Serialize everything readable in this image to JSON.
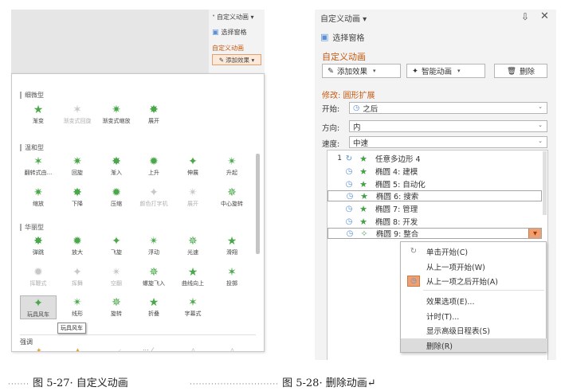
{
  "left_panel": {
    "pane_title": "自定义动画 ▾",
    "select_pane": "选择窗格",
    "subheading": "自定义动画",
    "add_effect": "添加效果 ▾",
    "sections": [
      {
        "title": "细微型",
        "items": [
          {
            "label": "渐变",
            "grey": false
          },
          {
            "label": "渐变式回旋",
            "grey": true
          },
          {
            "label": "渐变式缩放",
            "grey": false
          },
          {
            "label": "展开",
            "grey": false
          }
        ]
      },
      {
        "title": "温和型",
        "items": [
          {
            "label": "翻转式由...",
            "grey": false
          },
          {
            "label": "回旋",
            "grey": false
          },
          {
            "label": "渐入",
            "grey": false
          },
          {
            "label": "上升",
            "grey": false
          },
          {
            "label": "伸展",
            "grey": false
          },
          {
            "label": "升起",
            "grey": false
          },
          {
            "label": "缩放",
            "grey": false
          },
          {
            "label": "下降",
            "grey": false
          },
          {
            "label": "压缩",
            "grey": false
          },
          {
            "label": "颜色打字机",
            "grey": true
          },
          {
            "label": "展开",
            "grey": true
          },
          {
            "label": "中心旋转",
            "grey": false
          }
        ]
      },
      {
        "title": "华丽型",
        "items": [
          {
            "label": "弹跳",
            "grey": false
          },
          {
            "label": "放大",
            "grey": false
          },
          {
            "label": "飞旋",
            "grey": false
          },
          {
            "label": "浮动",
            "grey": false
          },
          {
            "label": "光速",
            "grey": false
          },
          {
            "label": "滑翔",
            "grey": false
          },
          {
            "label": "挥鞭式",
            "grey": true
          },
          {
            "label": "挥舞",
            "grey": true
          },
          {
            "label": "空翻",
            "grey": true
          },
          {
            "label": "螺旋飞入",
            "grey": false
          },
          {
            "label": "曲线向上",
            "grey": false
          },
          {
            "label": "投掷",
            "grey": false
          },
          {
            "label": "玩具风车",
            "grey": false
          },
          {
            "label": "线形",
            "grey": false
          },
          {
            "label": "旋转",
            "grey": false
          },
          {
            "label": "折叠",
            "grey": false
          },
          {
            "label": "字幕式",
            "grey": false
          }
        ]
      }
    ],
    "tooltip": "玩具风车",
    "next_section": "强调",
    "more": "..."
  },
  "right_panel": {
    "pane_title": "自定义动画 ▾",
    "select_pane": "选择窗格",
    "heading": "自定义动画",
    "buttons": {
      "add_effect": "添加效果",
      "smart_animation": "智能动画",
      "delete": "删除"
    },
    "modify_label": "修改: 圆形扩展",
    "start_label": "开始:",
    "start_value": "之后",
    "direction_label": "方向:",
    "direction_value": "内",
    "speed_label": "速度:",
    "speed_value": "中速",
    "list": [
      {
        "num": "1",
        "text": "任意多边形 4"
      },
      {
        "num": "",
        "text": "椭圆 4: 建模"
      },
      {
        "num": "",
        "text": "椭圆 5: 自动化"
      },
      {
        "num": "",
        "text": "椭圆 6: 搜索"
      },
      {
        "num": "",
        "text": "椭圆 7: 管理"
      },
      {
        "num": "",
        "text": "椭圆 8: 开发"
      },
      {
        "num": "",
        "text": "椭圆 9: 整合"
      }
    ],
    "context_menu": [
      "单击开始(C)",
      "从上一项开始(W)",
      "从上一项之后开始(A)",
      "效果选项(E)...",
      "计时(T)...",
      "显示高级日程表(S)",
      "删除(R)"
    ]
  },
  "captions": {
    "left": "图 5-27· 自定义动画",
    "right": "图 5-28· 删除动画↵"
  },
  "colors": {
    "accent_orange": "#c55a11",
    "star_green": "#3fa045",
    "highlight_orange": "#f0a070"
  }
}
